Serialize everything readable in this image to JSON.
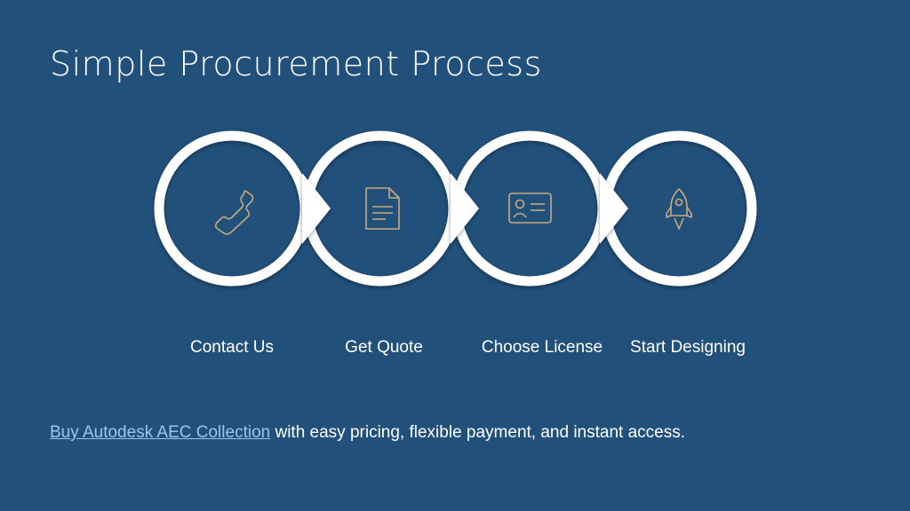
{
  "slide": {
    "title": "Simple Procurement Process"
  },
  "steps": [
    {
      "label": "Contact Us",
      "icon": "phone-icon"
    },
    {
      "label": "Get Quote",
      "icon": "document-icon"
    },
    {
      "label": "Choose License",
      "icon": "id-card-icon"
    },
    {
      "label": "Start Designing",
      "icon": "rocket-icon"
    }
  ],
  "footer": {
    "link_text": "Buy Autodesk AEC Collection",
    "text": " with easy pricing, flexible payment, and instant access."
  },
  "colors": {
    "background": "#21507b",
    "ring": "#ffffff",
    "icon": "#c8a97e",
    "link": "#9ec4f0"
  }
}
